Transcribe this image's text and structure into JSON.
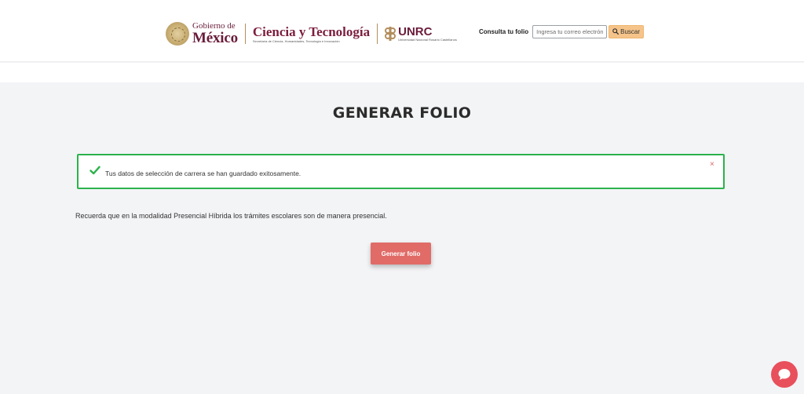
{
  "header": {
    "gob_mx": {
      "top": "Gobierno de",
      "bottom": "México"
    },
    "cyt": {
      "name": "Ciencia y Tecnología",
      "sub": "Secretaría de Ciencia, Humanidades, Tecnología e Innovación"
    },
    "unrc": {
      "name": "UNRC",
      "sub": "Universidad Nacional Rosario Castellanos"
    },
    "consulta": {
      "label": "Consulta tu folio",
      "placeholder": "Ingresa tu correo electrónico",
      "search_label": "Buscar"
    }
  },
  "main": {
    "title": "GENERAR FOLIO",
    "alert": {
      "text": "Tus datos de selección de carrera se han guardado exitosamente.",
      "close": "×",
      "color": "#2bb24c"
    },
    "info_text": "Recuerda que en la modalidad Presencial Híbrida los trámites escolares son de manera presencial.",
    "generar_button": "Generar folio"
  },
  "icons": {
    "search": "search-icon",
    "check": "check-icon",
    "chat": "chat-icon"
  },
  "colors": {
    "primary_button": "#e06b67",
    "search_button": "#f6c48a",
    "chat": "#e8505b",
    "brand": "#6a1c3a"
  }
}
